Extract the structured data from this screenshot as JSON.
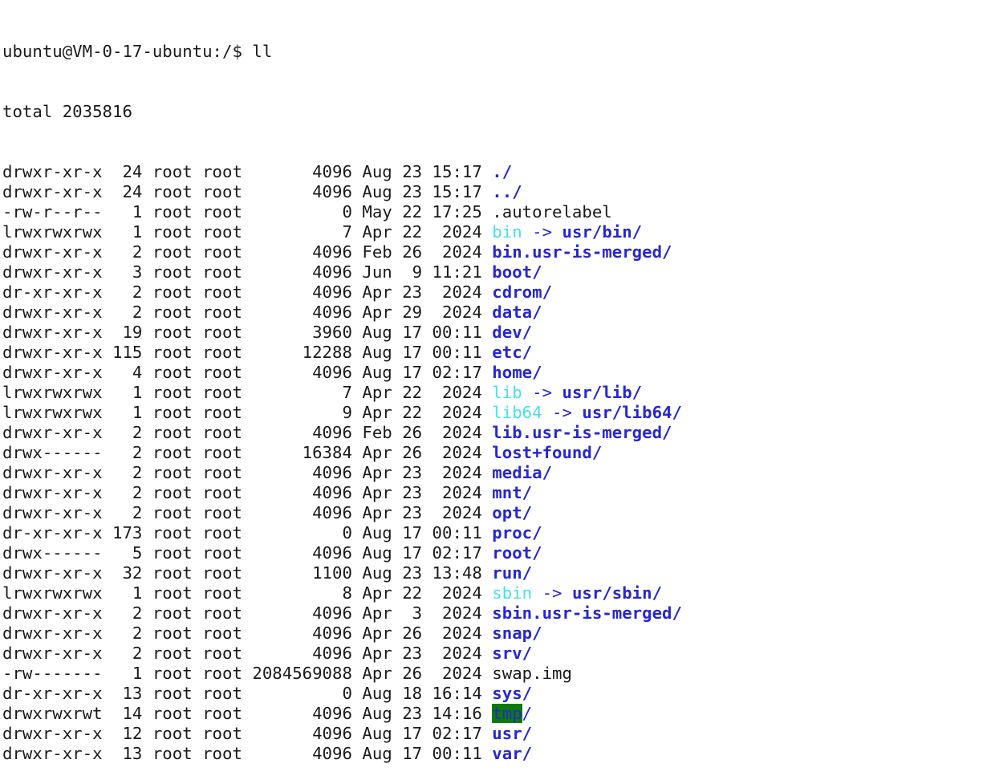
{
  "terminal": {
    "prompt": "ubuntu@VM-0-17-ubuntu:/$ ll",
    "total": "total 2035816",
    "colors": {
      "directory": "#2626d4",
      "symlink": "#45e0ea",
      "sticky_bg": "#0d7a0d",
      "text": "#1a1a1a"
    },
    "entries": [
      {
        "meta": "drwxr-xr-x  24 root root       4096 Aug 23 15:17 ",
        "name": "./",
        "type": "dir"
      },
      {
        "meta": "drwxr-xr-x  24 root root       4096 Aug 23 15:17 ",
        "name": "../",
        "type": "dir"
      },
      {
        "meta": "-rw-r--r--   1 root root          0 May 22 17:25 ",
        "name": ".autorelabel",
        "type": "file"
      },
      {
        "meta": "lrwxrwxrwx   1 root root          7 Apr 22  2024 ",
        "name": "bin",
        "type": "link",
        "target": "usr/bin/"
      },
      {
        "meta": "drwxr-xr-x   2 root root       4096 Feb 26  2024 ",
        "name": "bin.usr-is-merged/",
        "type": "dir"
      },
      {
        "meta": "drwxr-xr-x   3 root root       4096 Jun  9 11:21 ",
        "name": "boot/",
        "type": "dir"
      },
      {
        "meta": "dr-xr-xr-x   2 root root       4096 Apr 23  2024 ",
        "name": "cdrom/",
        "type": "dir"
      },
      {
        "meta": "drwxr-xr-x   2 root root       4096 Apr 29  2024 ",
        "name": "data/",
        "type": "dir"
      },
      {
        "meta": "drwxr-xr-x  19 root root       3960 Aug 17 00:11 ",
        "name": "dev/",
        "type": "dir"
      },
      {
        "meta": "drwxr-xr-x 115 root root      12288 Aug 17 00:11 ",
        "name": "etc/",
        "type": "dir"
      },
      {
        "meta": "drwxr-xr-x   4 root root       4096 Aug 17 02:17 ",
        "name": "home/",
        "type": "dir"
      },
      {
        "meta": "lrwxrwxrwx   1 root root          7 Apr 22  2024 ",
        "name": "lib",
        "type": "link",
        "target": "usr/lib/"
      },
      {
        "meta": "lrwxrwxrwx   1 root root          9 Apr 22  2024 ",
        "name": "lib64",
        "type": "link",
        "target": "usr/lib64/"
      },
      {
        "meta": "drwxr-xr-x   2 root root       4096 Feb 26  2024 ",
        "name": "lib.usr-is-merged/",
        "type": "dir"
      },
      {
        "meta": "drwx------   2 root root      16384 Apr 26  2024 ",
        "name": "lost+found/",
        "type": "dir"
      },
      {
        "meta": "drwxr-xr-x   2 root root       4096 Apr 23  2024 ",
        "name": "media/",
        "type": "dir"
      },
      {
        "meta": "drwxr-xr-x   2 root root       4096 Apr 23  2024 ",
        "name": "mnt/",
        "type": "dir"
      },
      {
        "meta": "drwxr-xr-x   2 root root       4096 Apr 23  2024 ",
        "name": "opt/",
        "type": "dir"
      },
      {
        "meta": "dr-xr-xr-x 173 root root          0 Aug 17 00:11 ",
        "name": "proc/",
        "type": "dir"
      },
      {
        "meta": "drwx------   5 root root       4096 Aug 17 02:17 ",
        "name": "root/",
        "type": "dir"
      },
      {
        "meta": "drwxr-xr-x  32 root root       1100 Aug 23 13:48 ",
        "name": "run/",
        "type": "dir"
      },
      {
        "meta": "lrwxrwxrwx   1 root root          8 Apr 22  2024 ",
        "name": "sbin",
        "type": "link",
        "target": "usr/sbin/"
      },
      {
        "meta": "drwxr-xr-x   2 root root       4096 Apr  3  2024 ",
        "name": "sbin.usr-is-merged/",
        "type": "dir"
      },
      {
        "meta": "drwxr-xr-x   2 root root       4096 Apr 26  2024 ",
        "name": "snap/",
        "type": "dir"
      },
      {
        "meta": "drwxr-xr-x   2 root root       4096 Apr 23  2024 ",
        "name": "srv/",
        "type": "dir"
      },
      {
        "meta": "-rw-------   1 root root 2084569088 Apr 26  2024 ",
        "name": "swap.img",
        "type": "file"
      },
      {
        "meta": "dr-xr-xr-x  13 root root          0 Aug 18 16:14 ",
        "name": "sys/",
        "type": "dir"
      },
      {
        "meta": "drwxrwxrwt  14 root root       4096 Aug 23 14:16 ",
        "name": "tmp",
        "type": "sticky",
        "suffix": "/"
      },
      {
        "meta": "drwxr-xr-x  12 root root       4096 Aug 17 02:17 ",
        "name": "usr/",
        "type": "dir"
      },
      {
        "meta": "drwxr-xr-x  13 root root       4096 Aug 17 00:11 ",
        "name": "var/",
        "type": "dir"
      }
    ]
  }
}
